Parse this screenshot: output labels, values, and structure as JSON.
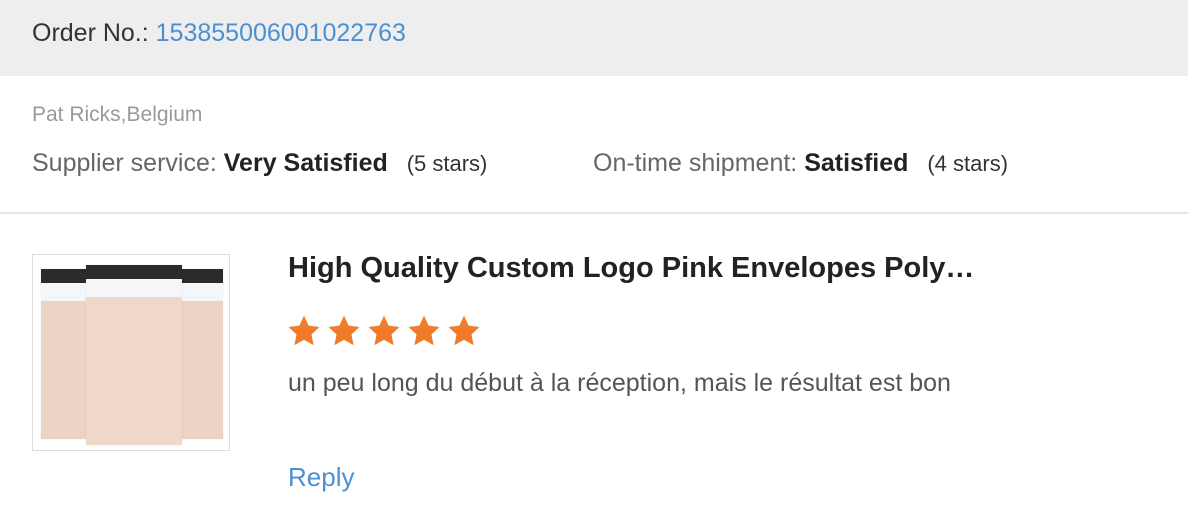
{
  "order": {
    "label": "Order No.:",
    "number": "153855006001022763"
  },
  "buyer": {
    "name_country": "Pat Ricks,Belgium"
  },
  "ratings": {
    "supplier_service": {
      "label": "Supplier service:",
      "value": "Very Satisfied",
      "stars_text": "(5 stars)",
      "stars": 5
    },
    "on_time_shipment": {
      "label": "On-time shipment:",
      "value": "Satisfied",
      "stars_text": "(4 stars)",
      "stars": 4
    }
  },
  "review": {
    "product_title": "High Quality Custom Logo Pink Envelopes Poly…",
    "rating": 5,
    "star_color": "#f07b2b",
    "comment": "un peu long du début à la réception, mais le résultat est bon",
    "reply_label": "Reply",
    "thumbnail_icon": "product-thumbnail-pink-envelopes"
  },
  "colors": {
    "link": "#4a90d2",
    "header_bg": "#eeeeee",
    "star": "#f07b2b"
  }
}
